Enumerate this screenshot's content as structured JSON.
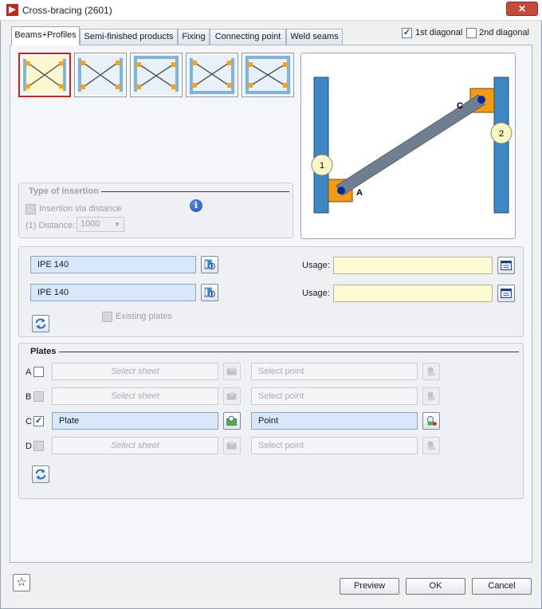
{
  "window": {
    "title": "Cross-bracing (2601)",
    "close_glyph": "✕"
  },
  "tabs": [
    {
      "label": "Beams+Profiles",
      "active": true
    },
    {
      "label": "Semi-finished products"
    },
    {
      "label": "Fixing"
    },
    {
      "label": "Connecting point"
    },
    {
      "label": "Weld seams"
    }
  ],
  "diagonals": {
    "first": {
      "label": "1st diagonal",
      "checked": true,
      "mark": "✓"
    },
    "second": {
      "label": "2nd diagonal",
      "checked": false
    }
  },
  "type_of_insertion": {
    "title": "Type of insertion",
    "via_distance_label": "Insertion via distance",
    "distance_label": "(1) Distance:",
    "distance_value": "1000",
    "info_glyph": "i"
  },
  "preview": {
    "label_1": "1",
    "label_2": "2",
    "label_a": "A",
    "label_c": "C"
  },
  "profiles": {
    "profile_1": "IPE 140",
    "profile_2": "IPE 140",
    "usage_label": "Usage:",
    "usage_1": "",
    "usage_2": "",
    "existing_plates_label": "Existing plates"
  },
  "plates": {
    "title": "Plates",
    "rows": [
      {
        "letter": "A",
        "checked": false,
        "sheet": "Select sheet",
        "point": "Select point"
      },
      {
        "letter": "B",
        "checked": false,
        "sheet": "Select sheet",
        "point": "Select point"
      },
      {
        "letter": "C",
        "checked": true,
        "sheet": "Plate",
        "point": "Point",
        "mark": "✓"
      },
      {
        "letter": "D",
        "checked": false,
        "sheet": "Select sheet",
        "point": "Select point"
      }
    ]
  },
  "buttons": {
    "preview": "Preview",
    "ok": "OK",
    "cancel": "Cancel",
    "favorite_glyph": "☆"
  },
  "colors": {
    "column": "#3d87c4",
    "plate": "#f39a16",
    "brace": "#6f7f8f",
    "accent": "#1a3e8c"
  }
}
